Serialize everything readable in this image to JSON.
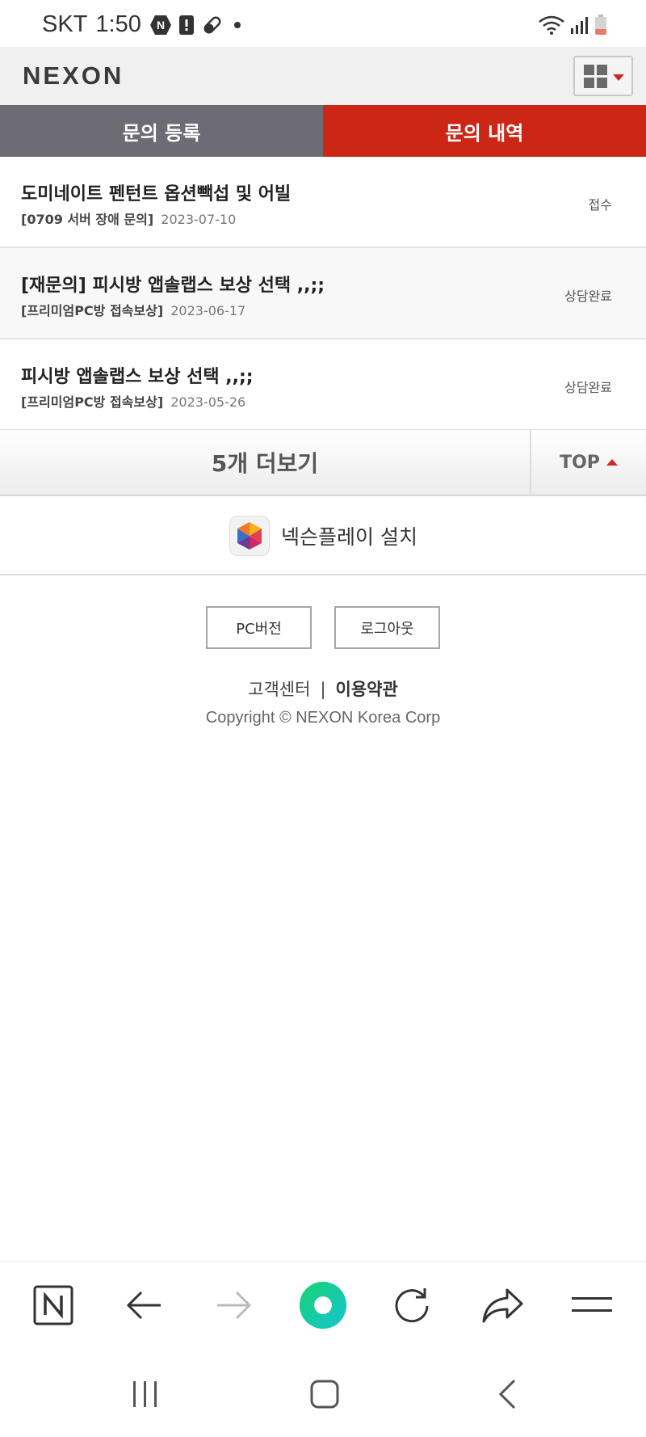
{
  "status_bar": {
    "carrier": "SKT",
    "time": "1:50",
    "notification_icons": [
      "naver-n-icon",
      "alert-icon",
      "pill-icon",
      "dot-icon"
    ],
    "system_icons": [
      "wifi-icon",
      "signal-icon",
      "battery-icon"
    ]
  },
  "header": {
    "logo": "NEXON",
    "menu_icon": "grid-menu-icon"
  },
  "tabs": [
    {
      "label": "문의 등록",
      "active": false
    },
    {
      "label": "문의 내역",
      "active": true
    }
  ],
  "inquiries": [
    {
      "title": "도미네이트 펜턴트 옵션빽섭 및 어빌",
      "category": "[0709 서버 장애 문의]",
      "date": "2023-07-10",
      "status": "접수"
    },
    {
      "title": "[재문의] 피시방 앱솔랩스 보상 선택 ,,;;",
      "category": "[프리미엄PC방 접속보상]",
      "date": "2023-06-17",
      "status": "상담완료"
    },
    {
      "title": "피시방 앱솔랩스 보상 선택 ,,;;",
      "category": "[프리미엄PC방 접속보상]",
      "date": "2023-05-26",
      "status": "상담완료"
    }
  ],
  "more": {
    "label": "5개 더보기",
    "top_label": "TOP"
  },
  "install": {
    "label": "넥슨플레이 설치"
  },
  "footer": {
    "pc_version": "PC버전",
    "logout": "로그아웃",
    "customer_center": "고객센터",
    "separator": "|",
    "terms": "이용약관",
    "copyright": "Copyright © NEXON Korea Corp"
  },
  "colors": {
    "accent_red": "#cc2617",
    "tab_gray": "#6d6c75",
    "header_bg": "#f0f0f0"
  },
  "browser_toolbar": [
    "naver-n-icon",
    "back-arrow-icon",
    "forward-arrow-icon",
    "green-dot-icon",
    "refresh-icon",
    "share-icon",
    "menu-icon"
  ],
  "android_nav": [
    "recent-apps-icon",
    "home-icon",
    "back-icon"
  ]
}
